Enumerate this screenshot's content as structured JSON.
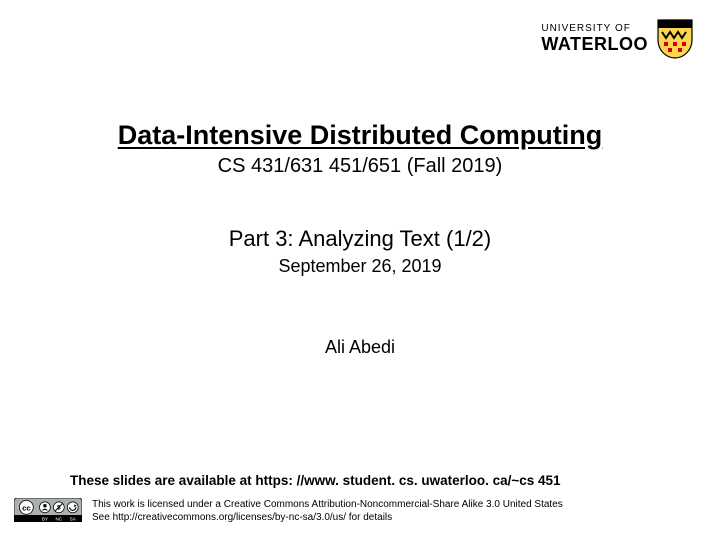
{
  "logo": {
    "line1": "UNIVERSITY OF",
    "line2": "WATERLOO"
  },
  "title": "Data-Intensive Distributed Computing",
  "course": "CS  431/631 451/651 (Fall 2019)",
  "part": "Part 3: Analyzing Text (1/2)",
  "date": "September 26, 2019",
  "author": "Ali Abedi",
  "availability": "These slides are available at https: //www. student. cs. uwaterloo. ca/~cs 451",
  "license": {
    "line1": "This work is licensed under a Creative Commons Attribution-Noncommercial-Share Alike 3.0 United States",
    "line2": "See http://creativecommons.org/licenses/by-nc-sa/3.0/us/ for details",
    "badge_labels": {
      "by": "BY",
      "nc": "NC",
      "sa": "SA"
    }
  }
}
